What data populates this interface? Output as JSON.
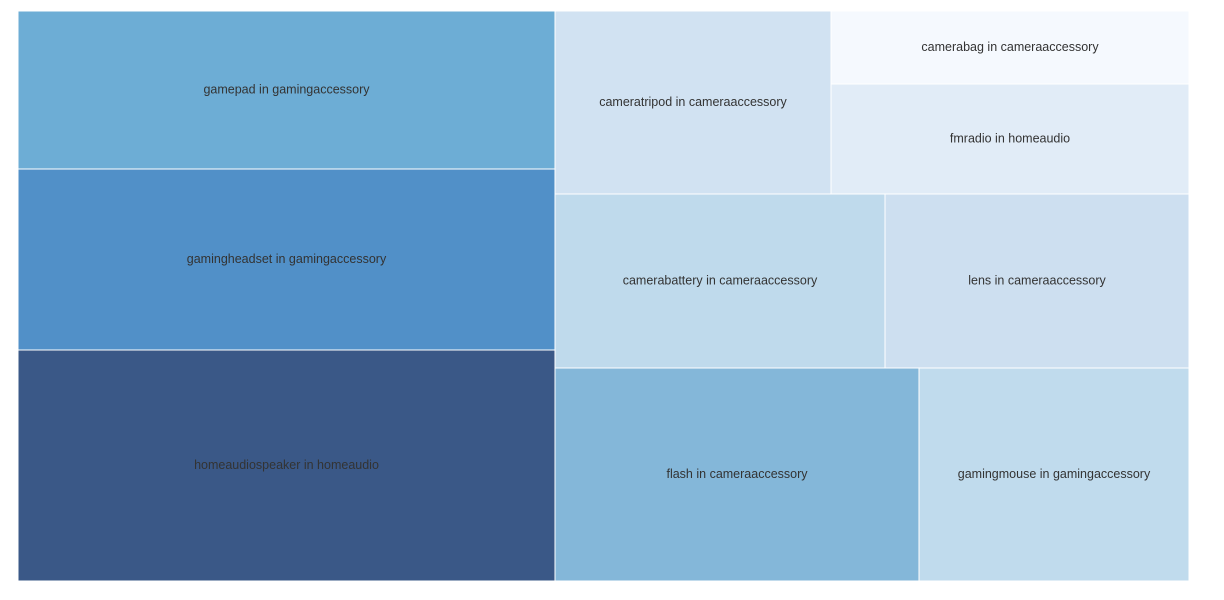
{
  "chart_data": {
    "type": "treemap",
    "title": "",
    "items": [
      {
        "label": "gamepad in gamingaccessory",
        "product": "gamepad",
        "category": "gamingaccessory",
        "value": 8.4,
        "color": "#6dadd5"
      },
      {
        "label": "gamingheadset in gamingaccessory",
        "product": "gamingheadset",
        "category": "gamingaccessory",
        "value": 9.7,
        "color": "#5190c8"
      },
      {
        "label": "homeaudiospeaker in homeaudio",
        "product": "homeaudiospeaker",
        "category": "homeaudio",
        "value": 12.4,
        "color": "#3a5887"
      },
      {
        "label": "cameratripod in cameraaccessory",
        "product": "cameratripod",
        "category": "cameraaccessory",
        "value": 3.1,
        "color": "#d1e2f2"
      },
      {
        "label": "camerabag in cameraaccessory",
        "product": "camerabag",
        "category": "cameraaccessory",
        "value": 1.3,
        "color": "#f5f9fe"
      },
      {
        "label": "fmradio in homeaudio",
        "product": "fmradio",
        "category": "homeaudio",
        "value": 2.0,
        "color": "#e1ecf7"
      },
      {
        "label": "camerabattery in cameraaccessory",
        "product": "camerabattery",
        "category": "cameraaccessory",
        "value": 5.4,
        "color": "#bfdaec"
      },
      {
        "label": "lens in cameraaccessory",
        "product": "lens",
        "category": "cameraaccessory",
        "value": 4.8,
        "color": "#cddff0"
      },
      {
        "label": "flash in cameraaccessory",
        "product": "flash",
        "category": "cameraaccessory",
        "value": 7.3,
        "color": "#84b7d9"
      },
      {
        "label": "gamingmouse in gamingaccessory",
        "product": "gamingmouse",
        "category": "gamingaccessory",
        "value": 5.4,
        "color": "#c0dbed"
      }
    ],
    "label_color": "#333333",
    "border_color": "#ffffff"
  }
}
